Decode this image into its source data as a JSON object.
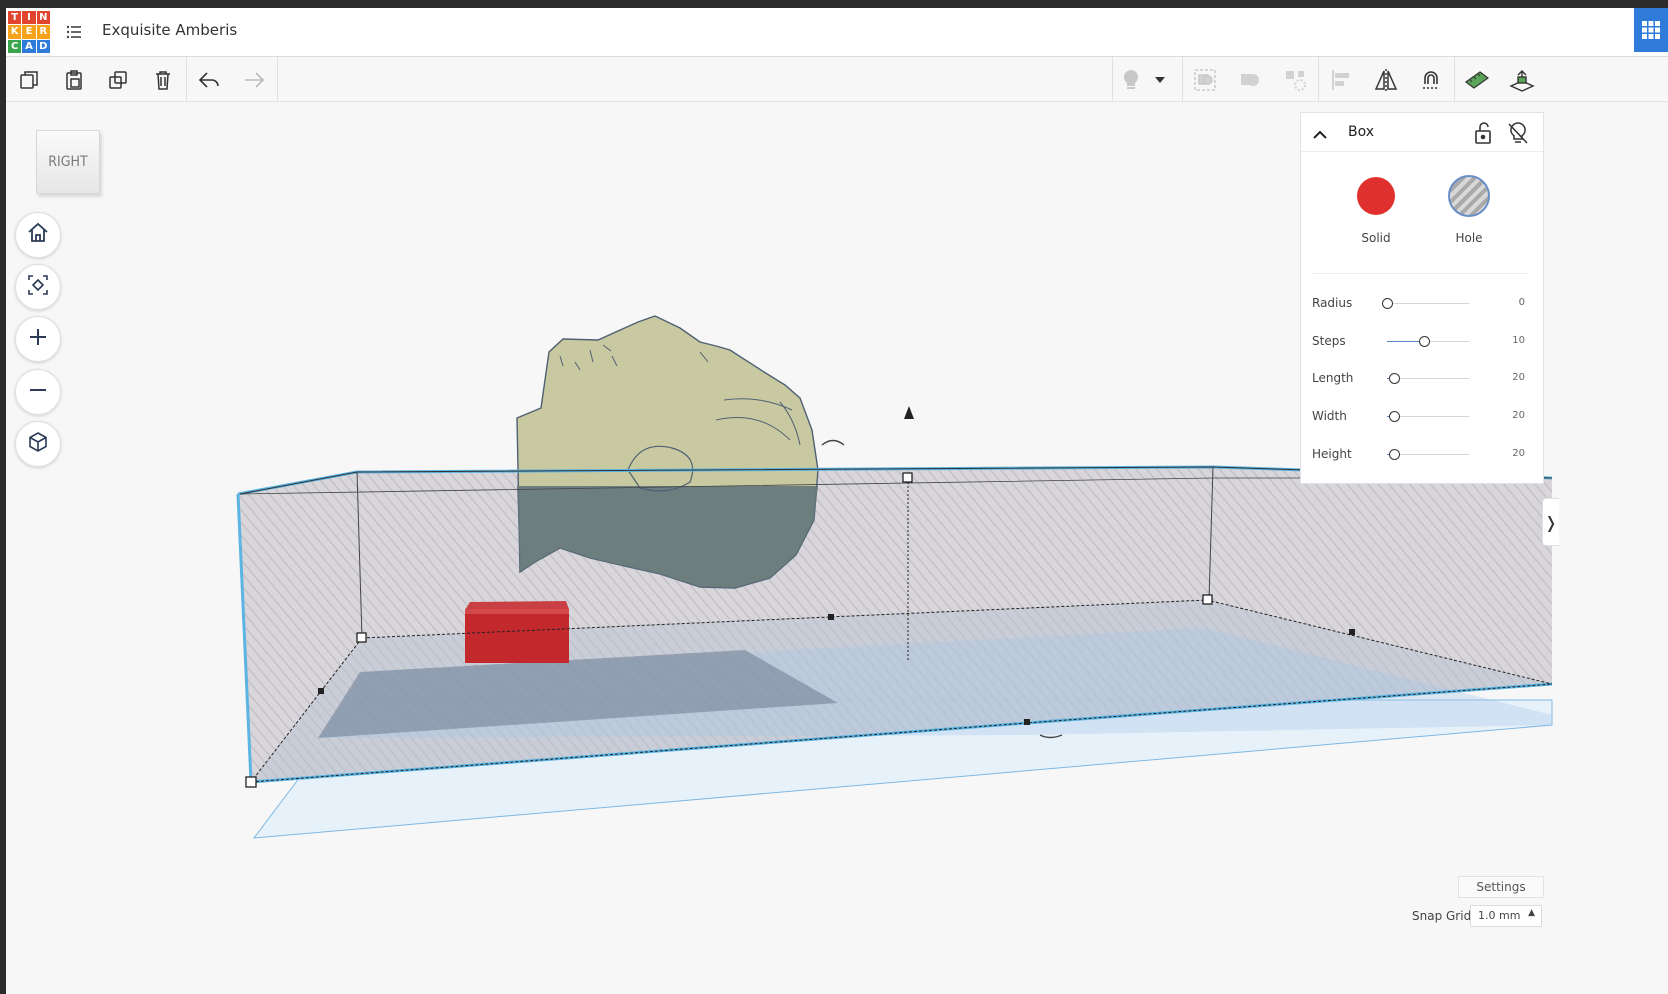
{
  "app": {
    "logo_letters": [
      "T",
      "I",
      "N",
      "K",
      "E",
      "R",
      "C",
      "A",
      "D"
    ],
    "logo_colors": [
      "#e2452d",
      "#e2452d",
      "#e2452d",
      "#f7a21b",
      "#f7a21b",
      "#f7a21b",
      "#3aa54b",
      "#2f7bd9",
      "#2f7bd9"
    ],
    "design_title": "Exquisite Amberis",
    "accent_color": "#2f7bd9"
  },
  "toolbar": {
    "left_icons": [
      "copy-icon",
      "paste-icon",
      "duplicate-icon",
      "delete-icon",
      "undo-icon",
      "redo-icon"
    ],
    "right_icons": [
      "light-bulb-icon",
      "dropdown-caret-icon",
      "group-icon",
      "ungroup-icon",
      "align-dots-icon",
      "align-icon",
      "mirror-icon",
      "magnet-icon",
      "ruler-icon",
      "workplane-icon"
    ]
  },
  "viewport": {
    "view_cube_label": "RIGHT",
    "nav_buttons": [
      "home-icon",
      "fit-view-icon",
      "zoom-in-icon",
      "zoom-out-icon",
      "perspective-cube-icon"
    ]
  },
  "inspector": {
    "shape_name": "Box",
    "solid_label": "Solid",
    "hole_label": "Hole",
    "solid_color": "#e0302d",
    "properties": [
      {
        "label": "Radius",
        "value": "0",
        "fraction": 0.0
      },
      {
        "label": "Steps",
        "value": "10",
        "fraction": 0.45
      },
      {
        "label": "Length",
        "value": "20",
        "fraction": 0.08
      },
      {
        "label": "Width",
        "value": "20",
        "fraction": 0.08
      },
      {
        "label": "Height",
        "value": "20",
        "fraction": 0.08
      }
    ]
  },
  "footer": {
    "settings_label": "Settings",
    "snap_grid_label": "Snap Grid",
    "snap_grid_value": "1.0 mm"
  }
}
